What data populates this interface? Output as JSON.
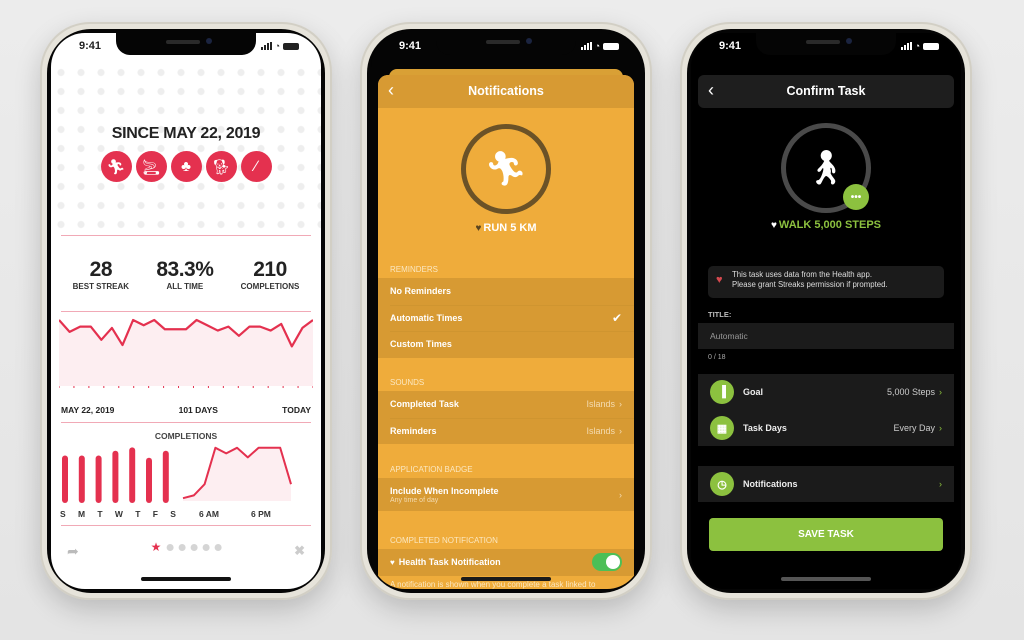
{
  "status_time": "9:41",
  "phone1": {
    "since_title": "SINCE MAY 22, 2019",
    "habit_icons": [
      "running-icon",
      "no-smoking-icon",
      "carrot-icon",
      "dog-icon",
      "toothbrush-icon"
    ],
    "accent_color": "#e4314f",
    "stats": [
      {
        "value": "28",
        "label": "BEST STREAK"
      },
      {
        "value": "83.3%",
        "label": "ALL TIME"
      },
      {
        "value": "210",
        "label": "COMPLETIONS"
      }
    ],
    "history_chart": {
      "type": "line",
      "start_label": "MAY 22, 2019",
      "span_label": "101 DAYS",
      "end_label": "TODAY",
      "values": [
        100,
        82,
        90,
        90,
        70,
        88,
        62,
        100,
        92,
        100,
        86,
        86,
        86,
        100,
        92,
        84,
        90,
        76,
        90,
        90,
        84,
        94,
        60,
        88,
        100
      ]
    },
    "completions_title": "COMPLETIONS",
    "weekday_chart": {
      "type": "bar",
      "categories": [
        "S",
        "M",
        "T",
        "W",
        "T",
        "F",
        "S"
      ],
      "values": [
        82,
        82,
        82,
        90,
        96,
        78,
        90
      ]
    },
    "hour_chart": {
      "type": "area",
      "tick_labels": [
        "6 AM",
        "6 PM"
      ],
      "values": [
        5,
        10,
        30,
        95,
        85,
        95,
        78,
        95,
        95,
        95,
        30
      ]
    },
    "pager": {
      "pages": 6,
      "active": 0
    }
  },
  "phone2": {
    "title": "Notifications",
    "task_name": "RUN 5 KM",
    "accent_color": "#efac3b",
    "sections": {
      "reminders": "REMINDERS",
      "sounds": "SOUNDS",
      "badge": "APPLICATION BADGE",
      "completed": "COMPLETED NOTIFICATION"
    },
    "reminder_options": [
      {
        "label": "No Reminders",
        "selected": false
      },
      {
        "label": "Automatic Times",
        "selected": true
      },
      {
        "label": "Custom Times",
        "selected": false
      }
    ],
    "sound_rows": [
      {
        "label": "Completed Task",
        "value": "Islands"
      },
      {
        "label": "Reminders",
        "value": "Islands"
      }
    ],
    "badge_row": {
      "label": "Include When Incomplete",
      "sub": "Any time of day"
    },
    "health_row": {
      "label": "Health Task Notification",
      "enabled": true
    },
    "footnote": "A notification is shown when you complete a task linked to"
  },
  "phone3": {
    "title": "Confirm Task",
    "task_name": "WALK 5,000 STEPS",
    "accent_color": "#8cc13f",
    "health_note": [
      "This task uses data from the Health app.",
      "Please grant Streaks permission if prompted."
    ],
    "title_label": "TITLE:",
    "title_placeholder": "Automatic",
    "char_count": "0 / 18",
    "rows": [
      {
        "label": "Goal",
        "value": "5,000 Steps",
        "icon": "signal-bars-icon"
      },
      {
        "label": "Task Days",
        "value": "Every Day",
        "icon": "calendar-icon"
      }
    ],
    "notifications_row": "Notifications",
    "save_label": "SAVE TASK"
  }
}
